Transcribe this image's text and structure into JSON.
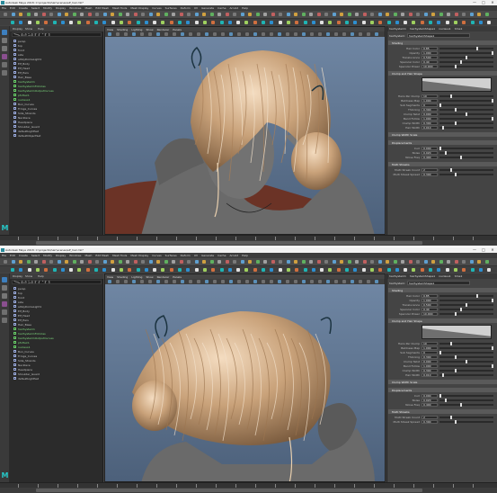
{
  "windows": [
    {
      "title": "Autodesk Maya 2018: C:\\projects\\hair\\scenes\\elf_hair.mb*",
      "window_controls": [
        "—",
        "□",
        "✕"
      ],
      "menus": [
        "File",
        "Edit",
        "Create",
        "Select",
        "Modify",
        "Display",
        "Windows",
        "Mesh",
        "Edit Mesh",
        "Mesh Tools",
        "Mesh Display",
        "Curves",
        "Surfaces",
        "Deform",
        "UV",
        "Generate",
        "Cache",
        "Arnold",
        "Help"
      ],
      "outliner": {
        "menus": [
          "Display",
          "Show",
          "Help"
        ],
        "search_placeholder": "Search...",
        "items": [
          {
            "label": "persp",
            "kind": "camera"
          },
          {
            "label": "top",
            "kind": "camera"
          },
          {
            "label": "front",
            "kind": "camera"
          },
          {
            "label": "side",
            "kind": "camera"
          },
          {
            "label": "aiSkyDomeLight1",
            "kind": "light"
          },
          {
            "label": "Elf_Body",
            "kind": "mesh"
          },
          {
            "label": "Elf_Head",
            "kind": "mesh"
          },
          {
            "label": "Elf_Ears",
            "kind": "mesh"
          },
          {
            "label": "Hair_Base",
            "kind": "mesh"
          },
          {
            "label": "hairSystem1",
            "kind": "hair",
            "highlight": true
          },
          {
            "label": "hairSystem1Follicles",
            "kind": "hair",
            "highlight": true
          },
          {
            "label": "hairSystem1OutputCurves",
            "kind": "hair",
            "highlight": true
          },
          {
            "label": "pfxHair1",
            "kind": "hair",
            "highlight": true
          },
          {
            "label": "nucleus1",
            "kind": "hair",
            "highlight": true
          },
          {
            "label": "Bun_Curves",
            "kind": "group"
          },
          {
            "label": "Fringe_Curves",
            "kind": "group"
          },
          {
            "label": "Side_Strands",
            "kind": "group"
          },
          {
            "label": "Necklace",
            "kind": "mesh"
          },
          {
            "label": "Headpiece",
            "kind": "mesh"
          },
          {
            "label": "Shoulder_Guard",
            "kind": "mesh"
          },
          {
            "label": "defaultLightSet",
            "kind": "set"
          },
          {
            "label": "defaultObjectSet",
            "kind": "set"
          }
        ]
      },
      "viewport": {
        "menus": [
          "View",
          "Shading",
          "Lighting",
          "Show",
          "Renderer",
          "Panels"
        ],
        "camera": "persp"
      },
      "attribute_editor": {
        "tabs": [
          "hairSystem1",
          "hairSystemShape1",
          "nucleus1",
          "time1"
        ],
        "node_label": "hairSystem:",
        "node_value": "hairSystemShape1",
        "sections": [
          {
            "label": "Shading",
            "rows": [
              {
                "label": "Hair Color",
                "value": "0.85",
                "slider": 0.7
              },
              {
                "label": "Opacity",
                "value": "1.000",
                "slider": 1.0
              },
              {
                "label": "Translucence",
                "value": "0.500",
                "slider": 0.5
              },
              {
                "label": "Specular Color",
                "value": "0.40",
                "slider": 0.4
              },
              {
                "label": "Specular Power",
                "value": "10.000",
                "slider": 0.3
              }
            ]
          },
          {
            "label": "Clump and Hair Shape",
            "rows": [
              {
                "label": "Hairs Per Clump",
                "value": "10",
                "slider": 0.2
              },
              {
                "label": "Baldness Map",
                "value": "1.000",
                "slider": 1.0
              },
              {
                "label": "Sub Segments",
                "value": "0",
                "slider": 0.0
              },
              {
                "label": "Thinning",
                "value": "0.300",
                "slider": 0.3
              },
              {
                "label": "Clump Twist",
                "value": "0.000",
                "slider": 0.5
              },
              {
                "label": "Bend Follow",
                "value": "1.000",
                "slider": 1.0
              },
              {
                "label": "Clump Width",
                "value": "0.300",
                "slider": 0.3
              },
              {
                "label": "Hair Width",
                "value": "0.010",
                "slider": 0.05
              }
            ]
          },
          {
            "label": "Clump Width Scale",
            "rows": []
          },
          {
            "label": "Displacements",
            "rows": [
              {
                "label": "Curl",
                "value": "0.000",
                "slider": 0.0
              },
              {
                "label": "Noise",
                "value": "0.020",
                "slider": 0.1
              },
              {
                "label": "Noise Freq",
                "value": "0.400",
                "slider": 0.4
              }
            ]
          },
          {
            "label": "Multi Streaks",
            "rows": [
              {
                "label": "Multi Streak Count",
                "value": "2",
                "slider": 0.2
              },
              {
                "label": "Multi Streak Spread",
                "value": "0.300",
                "slider": 0.3
              }
            ]
          }
        ]
      },
      "timeline_ticks": 24
    },
    {
      "title": "Autodesk Maya 2018: C:\\projects\\hair\\scenes\\elf_hair.mb*",
      "window_controls": [
        "—",
        "□",
        "✕"
      ],
      "menus": [
        "File",
        "Edit",
        "Create",
        "Select",
        "Modify",
        "Display",
        "Windows",
        "Mesh",
        "Edit Mesh",
        "Mesh Tools",
        "Mesh Display",
        "Curves",
        "Surfaces",
        "Deform",
        "UV",
        "Generate",
        "Cache",
        "Arnold",
        "Help"
      ],
      "outliner": {
        "menus": [
          "Display",
          "Show",
          "Help"
        ],
        "search_placeholder": "Search...",
        "items": [
          {
            "label": "persp",
            "kind": "camera"
          },
          {
            "label": "top",
            "kind": "camera"
          },
          {
            "label": "front",
            "kind": "camera"
          },
          {
            "label": "side",
            "kind": "camera"
          },
          {
            "label": "aiSkyDomeLight1",
            "kind": "light"
          },
          {
            "label": "Elf_Body",
            "kind": "mesh"
          },
          {
            "label": "Elf_Head",
            "kind": "mesh"
          },
          {
            "label": "Elf_Ears",
            "kind": "mesh"
          },
          {
            "label": "Hair_Base",
            "kind": "mesh"
          },
          {
            "label": "hairSystem1",
            "kind": "hair",
            "highlight": true
          },
          {
            "label": "hairSystem1Follicles",
            "kind": "hair",
            "highlight": true
          },
          {
            "label": "hairSystem1OutputCurves",
            "kind": "hair",
            "highlight": true
          },
          {
            "label": "pfxHair1",
            "kind": "hair",
            "highlight": true
          },
          {
            "label": "nucleus1",
            "kind": "hair",
            "highlight": true
          },
          {
            "label": "Bun_Curves",
            "kind": "group"
          },
          {
            "label": "Fringe_Curves",
            "kind": "group"
          },
          {
            "label": "Side_Strands",
            "kind": "group"
          },
          {
            "label": "Necklace",
            "kind": "mesh"
          },
          {
            "label": "Headpiece",
            "kind": "mesh"
          },
          {
            "label": "Shoulder_Guard",
            "kind": "mesh"
          },
          {
            "label": "defaultLightSet",
            "kind": "set"
          }
        ]
      },
      "viewport": {
        "menus": [
          "View",
          "Shading",
          "Lighting",
          "Show",
          "Renderer",
          "Panels"
        ],
        "camera": "persp"
      },
      "attribute_editor": {
        "tabs": [
          "hairSystem1",
          "hairSystemShape1",
          "nucleus1",
          "time1"
        ],
        "node_label": "hairSystem:",
        "node_value": "hairSystemShape1",
        "sections": [
          {
            "label": "Shading",
            "rows": [
              {
                "label": "Hair Color",
                "value": "0.85",
                "slider": 0.7
              },
              {
                "label": "Opacity",
                "value": "1.000",
                "slider": 1.0
              },
              {
                "label": "Translucence",
                "value": "0.500",
                "slider": 0.5
              },
              {
                "label": "Specular Color",
                "value": "0.40",
                "slider": 0.4
              },
              {
                "label": "Specular Power",
                "value": "10.000",
                "slider": 0.3
              }
            ]
          },
          {
            "label": "Clump and Hair Shape",
            "rows": [
              {
                "label": "Hairs Per Clump",
                "value": "10",
                "slider": 0.2
              },
              {
                "label": "Baldness Map",
                "value": "1.000",
                "slider": 1.0
              },
              {
                "label": "Sub Segments",
                "value": "0",
                "slider": 0.0
              },
              {
                "label": "Thinning",
                "value": "0.300",
                "slider": 0.3
              },
              {
                "label": "Clump Twist",
                "value": "0.000",
                "slider": 0.5
              },
              {
                "label": "Bend Follow",
                "value": "1.000",
                "slider": 1.0
              },
              {
                "label": "Clump Width",
                "value": "0.300",
                "slider": 0.3
              },
              {
                "label": "Hair Width",
                "value": "0.010",
                "slider": 0.05
              }
            ]
          },
          {
            "label": "Clump Width Scale",
            "rows": []
          },
          {
            "label": "Displacements",
            "rows": [
              {
                "label": "Curl",
                "value": "0.000",
                "slider": 0.0
              },
              {
                "label": "Noise",
                "value": "0.020",
                "slider": 0.1
              },
              {
                "label": "Noise Freq",
                "value": "0.400",
                "slider": 0.4
              }
            ]
          },
          {
            "label": "Multi Streaks",
            "rows": [
              {
                "label": "Multi Streak Count",
                "value": "2",
                "slider": 0.2
              },
              {
                "label": "Multi Streak Spread",
                "value": "0.300",
                "slider": 0.3
              }
            ]
          }
        ]
      },
      "timeline_ticks": 24
    }
  ],
  "colors": {
    "ui_bg": "#444444",
    "viewport_bg": "#5a6f88",
    "hair": "#c9a27a",
    "skin": "#6a6a6a",
    "accent": "#26c6c6",
    "outliner_highlight": "#7fdc7f"
  },
  "icons": {
    "toolbox": [
      "select-tool-icon",
      "lasso-tool-icon",
      "paint-select-icon",
      "move-tool-icon",
      "rotate-tool-icon",
      "scale-tool-icon"
    ],
    "logo": "maya-logo"
  },
  "logo_letter": "M"
}
